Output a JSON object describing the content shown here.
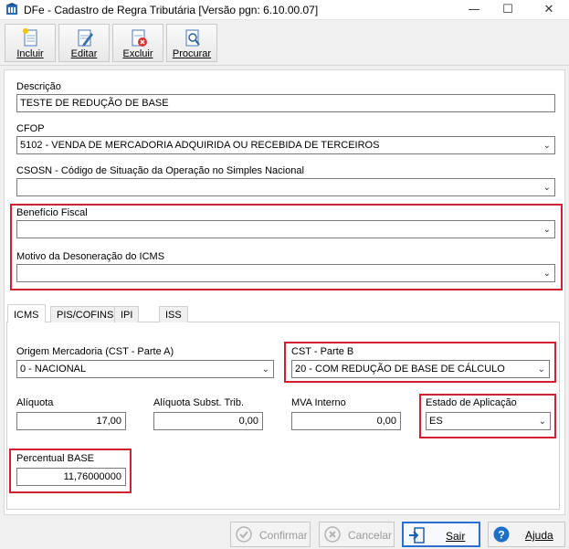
{
  "window": {
    "title": "DFe - Cadastro de Regra Tributária [Versão pgn: 6.10.00.07]",
    "controls": {
      "minimize": "—",
      "maximize": "☐",
      "close": "✕"
    }
  },
  "toolbar": {
    "incluir": "Incluir",
    "editar": "Editar",
    "excluir": "Excluir",
    "procurar": "Procurar"
  },
  "form": {
    "descricao": {
      "label": "Descrição",
      "value": "TESTE DE REDUÇÃO DE BASE"
    },
    "cfop": {
      "label": "CFOP",
      "value": "5102 - VENDA DE MERCADORIA ADQUIRIDA OU RECEBIDA DE TERCEIROS"
    },
    "csosn": {
      "label": "CSOSN - Código de Situação da Operação no Simples Nacional",
      "value": ""
    },
    "beneficio": {
      "label": "Benefício Fiscal",
      "value": ""
    },
    "motivo": {
      "label": "Motivo da Desoneração do ICMS",
      "value": ""
    }
  },
  "tabs": [
    "ICMS",
    "PIS/COFINS",
    "IPI",
    "ISS"
  ],
  "icms": {
    "origem": {
      "label": "Origem Mercadoria (CST - Parte A)",
      "value": "0 - NACIONAL"
    },
    "cst_b": {
      "label": "CST - Parte B",
      "value": "20 - COM REDUÇÃO DE BASE DE CÁLCULO"
    },
    "aliquota": {
      "label": "Alíquota",
      "value": "17,00"
    },
    "aliquota_st": {
      "label": "Alíquota Subst. Trib.",
      "value": "0,00"
    },
    "mva": {
      "label": "MVA Interno",
      "value": "0,00"
    },
    "estado": {
      "label": "Estado de Aplicação",
      "value": "ES"
    },
    "percentual": {
      "label": "Percentual BASE",
      "value": "11,76000000"
    }
  },
  "buttons": {
    "confirmar": "Confirmar",
    "cancelar": "Cancelar",
    "sair": "Sair",
    "ajuda": "Ajuda"
  },
  "colors": {
    "highlight": "#d32030",
    "accent": "#1e6fc8"
  }
}
